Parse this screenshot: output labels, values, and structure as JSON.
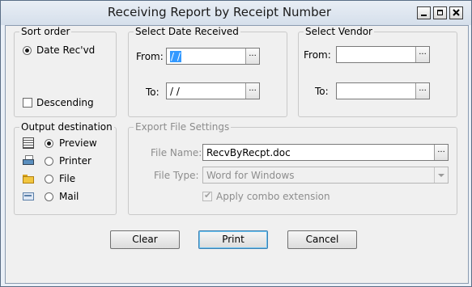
{
  "window": {
    "title": "Receiving Report by Receipt Number"
  },
  "sort_order": {
    "legend": "Sort order",
    "option": "Date Rec'vd",
    "descending_label": "Descending",
    "descending_checked": false
  },
  "date_received": {
    "legend": "Select Date Received",
    "from_label": "From:",
    "from_value": "/ /",
    "to_label": "To:",
    "to_value": "/ /",
    "browse_label": "..."
  },
  "vendor": {
    "legend": "Select Vendor",
    "from_label": "From:",
    "from_value": "",
    "to_label": "To:",
    "to_value": "",
    "browse_label": "..."
  },
  "output": {
    "legend": "Output destination",
    "options": [
      {
        "label": "Preview",
        "icon": "preview-icon",
        "selected": true
      },
      {
        "label": "Printer",
        "icon": "printer-icon",
        "selected": false
      },
      {
        "label": "File",
        "icon": "folder-icon",
        "selected": false
      },
      {
        "label": "Mail",
        "icon": "mail-icon",
        "selected": false
      }
    ]
  },
  "export": {
    "legend": "Export  File Settings",
    "file_name_label": "File Name:",
    "file_name_value": "RecvByRecpt.doc",
    "file_type_label": "File Type:",
    "file_type_value": "Word for Windows",
    "combo_label": "Apply combo extension",
    "combo_checked": true,
    "browse_label": "..."
  },
  "buttons": {
    "clear": "Clear",
    "print": "Print",
    "cancel": "Cancel"
  },
  "colors": {
    "selection": "#3399ff",
    "default_button_border": "#3c7fb1",
    "window_frame": "#5a6e86"
  }
}
